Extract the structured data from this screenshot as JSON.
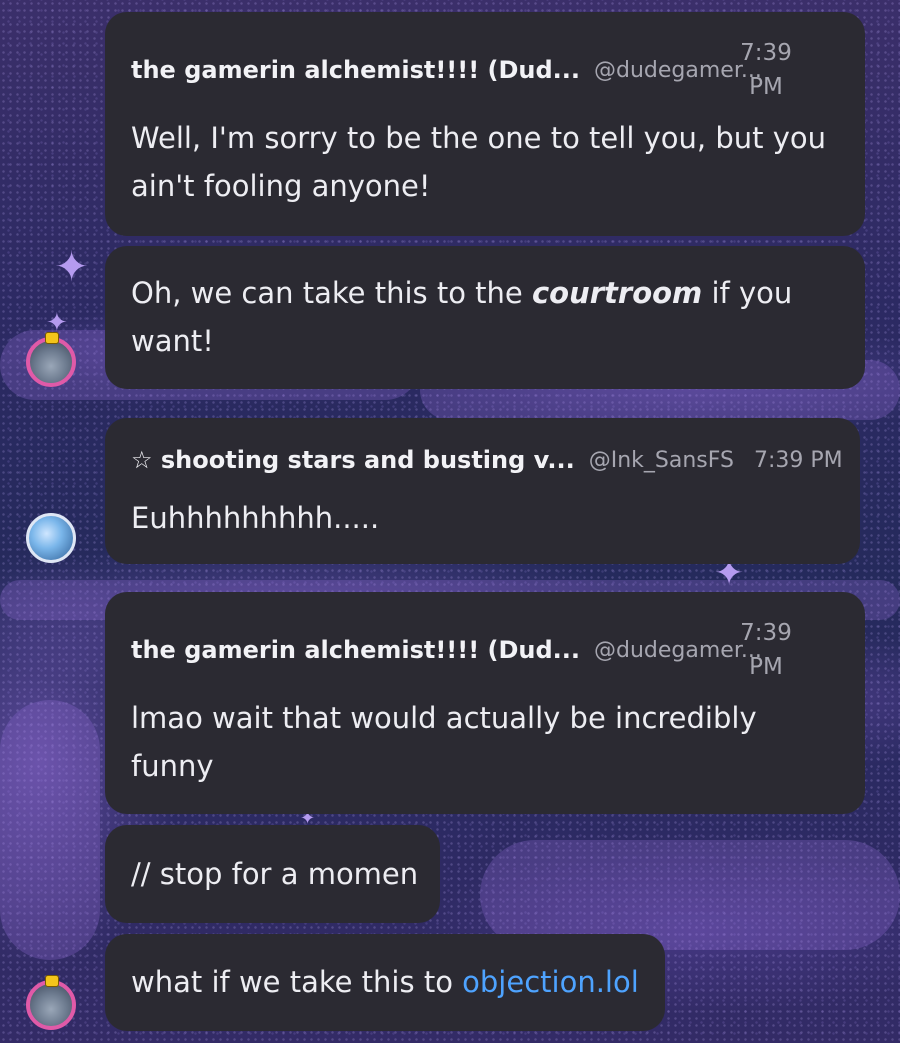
{
  "messages": [
    {
      "author": "the gamerin alchemist!!!! (Dud...",
      "handle": "@dudegamer...",
      "time_line1": "7:39",
      "time_line2": "PM",
      "text": "Well, I'm sorry to be the one to tell you, but you ain't fooling anyone!"
    },
    {
      "text_before": "Oh, we can take this to the ",
      "text_bold": "courtroom",
      "text_after": " if you want!"
    },
    {
      "author": "☆ shooting stars and busting v...",
      "handle": "@Ink_SansFS",
      "time": "7:39 PM",
      "text": "Euhhhhhhhhh....."
    },
    {
      "author": "the gamerin alchemist!!!! (Dud...",
      "handle": "@dudegamer...",
      "time_line1": "7:39",
      "time_line2": "PM",
      "text": "lmao wait that would actually be incredibly funny"
    },
    {
      "text": "// stop for a momen"
    },
    {
      "text_before": "what if we take this to ",
      "link": "objection.lol"
    }
  ],
  "colors": {
    "bubble": "#2b2a32",
    "link": "#4ea3ff",
    "avatar_ring": "#e05aa8"
  },
  "icons": {
    "sparkle": "sparkle-icon",
    "avatar_badge": "padlock-badge-icon"
  }
}
